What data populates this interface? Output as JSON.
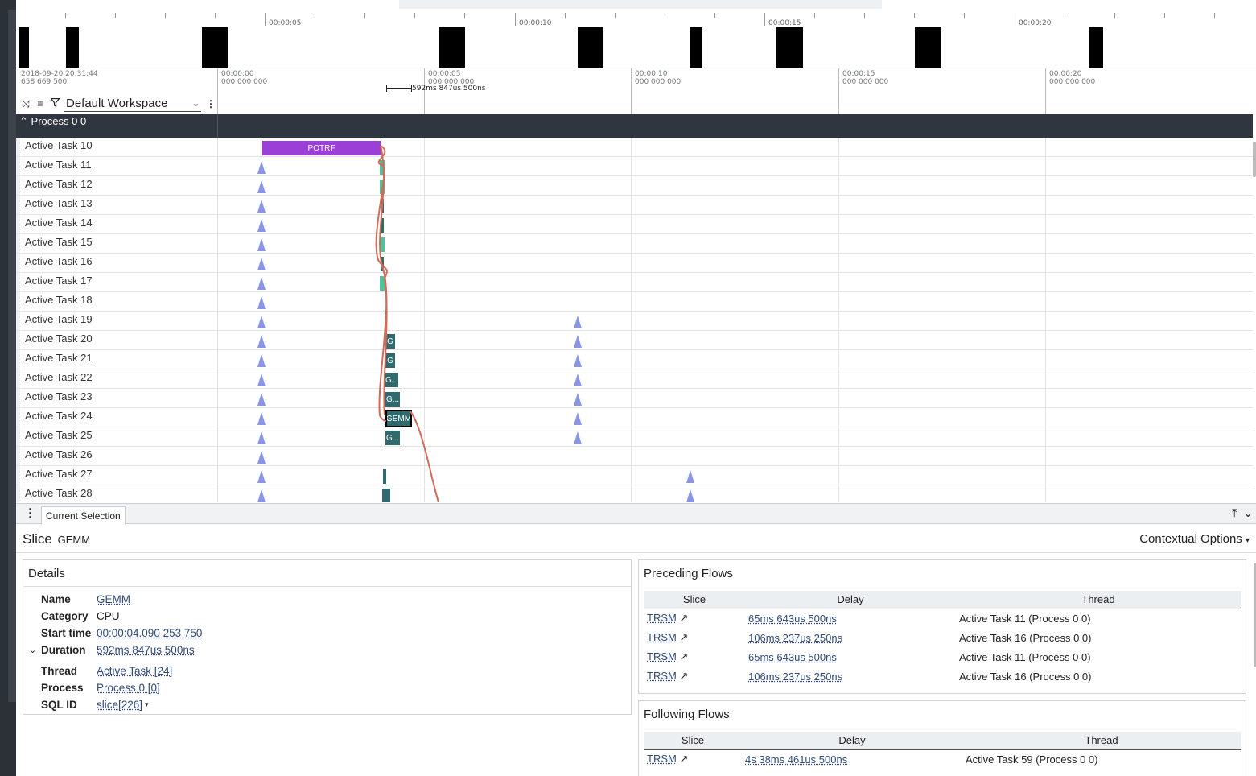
{
  "overview": {
    "ticks": [
      "00:00:05",
      "00:00:10",
      "00:00:15",
      "00:00:20"
    ]
  },
  "timeaxis": {
    "offset": [
      "2018-09-20 20:31:44",
      "658 669 500"
    ],
    "ticks": [
      {
        "time": "00:00:00",
        "ns": "000 000 000"
      },
      {
        "time": "00:00:05",
        "ns": "000 000 000"
      },
      {
        "time": "00:00:10",
        "ns": "000 000 000"
      },
      {
        "time": "00:00:15",
        "ns": "000 000 000"
      },
      {
        "time": "00:00:20",
        "ns": "000 000 000"
      }
    ],
    "span_label": "592ms 847us 500ns"
  },
  "workspace": {
    "name": "Default Workspace"
  },
  "process": {
    "label": "Process 0 0"
  },
  "tracks": [
    "Active Task 10",
    "Active Task 11",
    "Active Task 12",
    "Active Task 13",
    "Active Task 14",
    "Active Task 15",
    "Active Task 16",
    "Active Task 17",
    "Active Task 18",
    "Active Task 19",
    "Active Task 20",
    "Active Task 21",
    "Active Task 22",
    "Active Task 23",
    "Active Task 24",
    "Active Task 25",
    "Active Task 26",
    "Active Task 27",
    "Active Task 28"
  ],
  "slices": {
    "potrf": "POTRF",
    "g20": "G",
    "g21": "G",
    "g22": "G...",
    "g23": "G...",
    "gemm24": "GEMM",
    "g25": "G..."
  },
  "colors": {
    "potrf": "#9b3fd6",
    "gemm": "#2f6a6e",
    "trsm": "#4fc39a",
    "instant": "#8b95e6",
    "flow": "#d26a5a"
  },
  "bottom": {
    "tab": "Current Selection",
    "slice_prefix": "Slice",
    "slice_name": "GEMM",
    "contextual": "Contextual Options",
    "details": {
      "title": "Details",
      "rows": [
        {
          "k": "Name",
          "v": "GEMM"
        },
        {
          "k": "Category",
          "v": "CPU"
        },
        {
          "k": "Start time",
          "v": "00:00:04.090 253 750"
        },
        {
          "k": "Duration",
          "v": "592ms 847us 500ns"
        },
        {
          "k": "Thread",
          "v": "Active Task [24]"
        },
        {
          "k": "Process",
          "v": "Process 0 [0]"
        },
        {
          "k": "SQL ID",
          "v": "slice[226]"
        }
      ]
    },
    "preceding": {
      "title": "Preceding Flows",
      "headers": [
        "Slice",
        "Delay",
        "Thread"
      ],
      "rows": [
        {
          "slice": "TRSM",
          "delay": "65ms 643us 500ns",
          "thread": "Active Task 11 (Process 0 0)"
        },
        {
          "slice": "TRSM",
          "delay": "106ms 237us 250ns",
          "thread": "Active Task 16 (Process 0 0)"
        },
        {
          "slice": "TRSM",
          "delay": "65ms 643us 500ns",
          "thread": "Active Task 11 (Process 0 0)"
        },
        {
          "slice": "TRSM",
          "delay": "106ms 237us 250ns",
          "thread": "Active Task 16 (Process 0 0)"
        }
      ]
    },
    "following": {
      "title": "Following Flows",
      "headers": [
        "Slice",
        "Delay",
        "Thread"
      ],
      "rows": [
        {
          "slice": "TRSM",
          "delay": "4s 38ms 461us 500ns",
          "thread": "Active Task 59 (Process 0 0)"
        }
      ]
    }
  }
}
